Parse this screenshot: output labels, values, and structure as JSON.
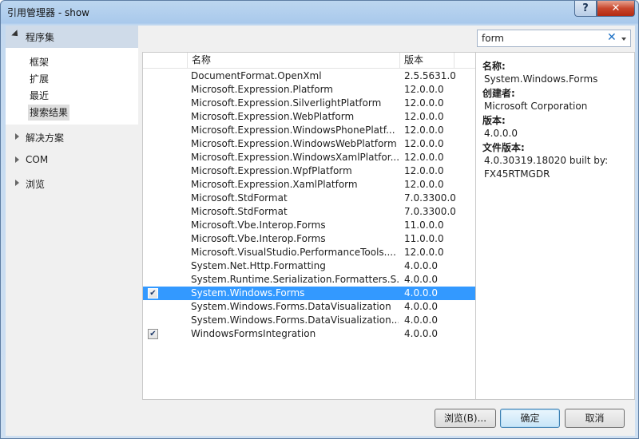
{
  "window": {
    "title": "引用管理器 - show",
    "help_label": "?",
    "close_label": "✕"
  },
  "sidebar": {
    "header": "程序集",
    "sub_items": [
      {
        "label": "框架"
      },
      {
        "label": "扩展"
      },
      {
        "label": "最近"
      },
      {
        "label": "搜索结果",
        "active": true
      }
    ],
    "groups": [
      {
        "label": "解决方案"
      },
      {
        "label": "COM"
      },
      {
        "label": "浏览"
      }
    ]
  },
  "search": {
    "value": "form",
    "clear_label": "✕"
  },
  "list": {
    "col_name": "名称",
    "col_version": "版本",
    "rows": [
      {
        "name": "DocumentFormat.OpenXml",
        "version": "2.5.5631.0",
        "checked": false
      },
      {
        "name": "Microsoft.Expression.Platform",
        "version": "12.0.0.0",
        "checked": false
      },
      {
        "name": "Microsoft.Expression.SilverlightPlatform",
        "version": "12.0.0.0",
        "checked": false
      },
      {
        "name": "Microsoft.Expression.WebPlatform",
        "version": "12.0.0.0",
        "checked": false
      },
      {
        "name": "Microsoft.Expression.WindowsPhonePlatf...",
        "version": "12.0.0.0",
        "checked": false
      },
      {
        "name": "Microsoft.Expression.WindowsWebPlatform",
        "version": "12.0.0.0",
        "checked": false
      },
      {
        "name": "Microsoft.Expression.WindowsXamlPlatfor...",
        "version": "12.0.0.0",
        "checked": false
      },
      {
        "name": "Microsoft.Expression.WpfPlatform",
        "version": "12.0.0.0",
        "checked": false
      },
      {
        "name": "Microsoft.Expression.XamlPlatform",
        "version": "12.0.0.0",
        "checked": false
      },
      {
        "name": "Microsoft.StdFormat",
        "version": "7.0.3300.0",
        "checked": false
      },
      {
        "name": "Microsoft.StdFormat",
        "version": "7.0.3300.0",
        "checked": false
      },
      {
        "name": "Microsoft.Vbe.Interop.Forms",
        "version": "11.0.0.0",
        "checked": false
      },
      {
        "name": "Microsoft.Vbe.Interop.Forms",
        "version": "11.0.0.0",
        "checked": false
      },
      {
        "name": "Microsoft.VisualStudio.PerformanceTools....",
        "version": "12.0.0.0",
        "checked": false
      },
      {
        "name": "System.Net.Http.Formatting",
        "version": "4.0.0.0",
        "checked": false
      },
      {
        "name": "System.Runtime.Serialization.Formatters.S...",
        "version": "4.0.0.0",
        "checked": false
      },
      {
        "name": "System.Windows.Forms",
        "version": "4.0.0.0",
        "checked": true,
        "selected": true
      },
      {
        "name": "System.Windows.Forms.DataVisualization",
        "version": "4.0.0.0",
        "checked": false
      },
      {
        "name": "System.Windows.Forms.DataVisualization....",
        "version": "4.0.0.0",
        "checked": false
      },
      {
        "name": "WindowsFormsIntegration",
        "version": "4.0.0.0",
        "checked": true
      }
    ]
  },
  "details": {
    "name_label": "名称:",
    "name_value": "System.Windows.Forms",
    "creator_label": "创建者:",
    "creator_value": "Microsoft Corporation",
    "version_label": "版本:",
    "version_value": "4.0.0.0",
    "file_version_label": "文件版本:",
    "file_version_value": "4.0.30319.18020 built by: FX45RTMGDR"
  },
  "buttons": {
    "browse": "浏览(B)...",
    "ok": "确定",
    "cancel": "取消"
  },
  "icons": {
    "check_glyph": "✔"
  }
}
